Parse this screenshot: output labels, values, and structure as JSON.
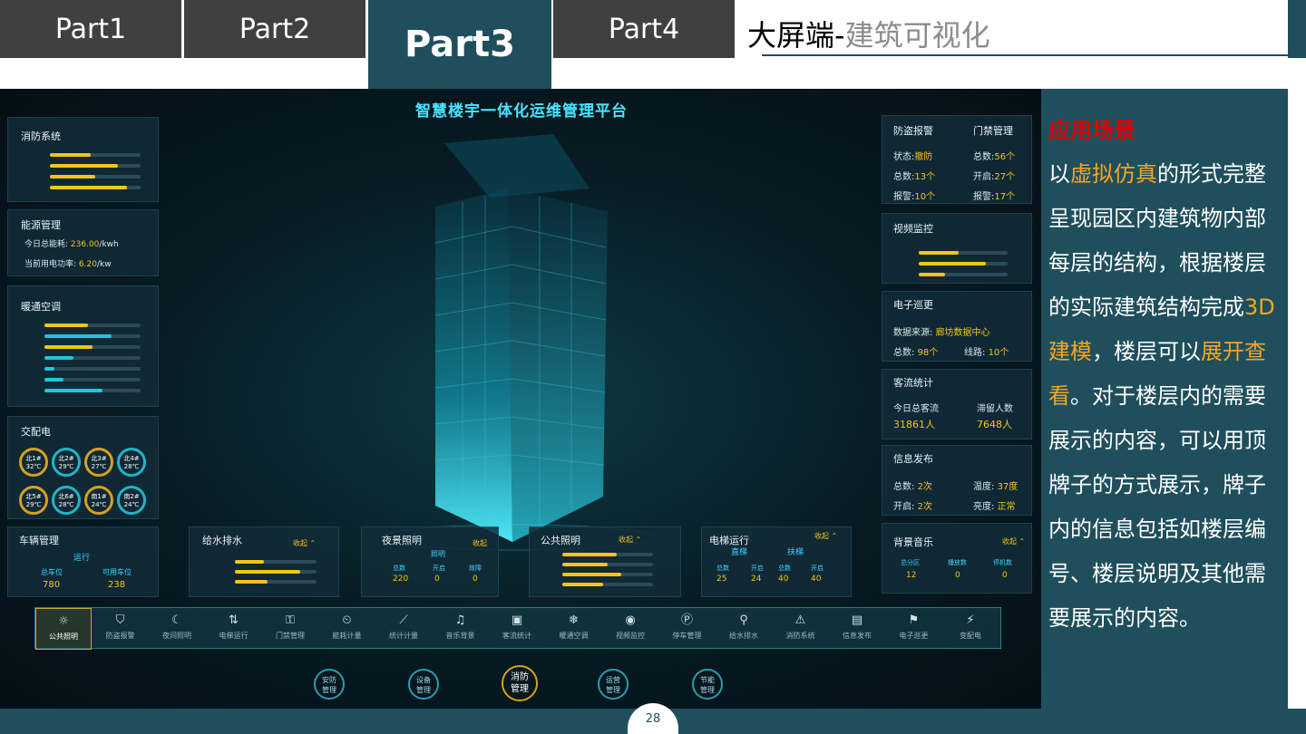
{
  "tabs": [
    {
      "label": "Part1"
    },
    {
      "label": "Part2"
    },
    {
      "label": "Part3"
    },
    {
      "label": "Part4"
    }
  ],
  "header": {
    "title_main": "大屏端-",
    "title_sub": "建筑可视化"
  },
  "platform": {
    "title": "智慧楼宇一体化运维管理平台"
  },
  "left": {
    "fire": {
      "title": "消防系统"
    },
    "energy": {
      "title": "能源管理",
      "today_label": "今日总能耗:",
      "today_value": "236.00",
      "today_unit": "/kwh",
      "power_label": "当前用电功率:",
      "power_value": "6.20",
      "power_unit": "/kw"
    },
    "hvac": {
      "title": "暖通空调"
    },
    "substation": {
      "title": "交配电",
      "rings": [
        "北1#\n32℃",
        "北2#\n29℃",
        "北3#\n27℃",
        "北4#\n28℃",
        "北5#\n29℃",
        "北6#\n28℃",
        "南1#\n24℃",
        "南2#\n24℃"
      ]
    },
    "vehicle": {
      "title": "车辆管理",
      "status": "运行",
      "total_label": "总车位",
      "total_value": "780",
      "free_label": "可用车位",
      "free_value": "238"
    }
  },
  "bottom_panels": {
    "water": {
      "title": "给水排水",
      "collapse": "收起 ⌃"
    },
    "night": {
      "title": "夜景照明",
      "collapse": "收起",
      "sub": "照明",
      "c1": "总数",
      "c2": "开启",
      "c3": "故障",
      "v1": "220",
      "v2": "0",
      "v3": "0"
    },
    "public": {
      "title": "公共照明",
      "collapse": "收起 ⌃"
    },
    "elevator": {
      "title": "电梯运行",
      "collapse": "收起 ⌃",
      "a": "直梯",
      "b": "扶梯",
      "c1": "总数",
      "c2": "开启",
      "c3": "总数",
      "c4": "开启",
      "v1": "25",
      "v2": "24",
      "v3": "40",
      "v4": "40"
    }
  },
  "right": {
    "security": {
      "title1": "防盗报警",
      "title2": "门禁管理",
      "status_label": "状态:",
      "status_value": "撤防",
      "total_label": "总数:",
      "total_value": "13个",
      "alarm_label": "报警:",
      "alarm_value": "10个",
      "d_total_label": "总数:",
      "d_total_value": "56个",
      "d_open_label": "开启:",
      "d_open_value": "27个",
      "d_alarm_label": "报警:",
      "d_alarm_value": "17个"
    },
    "video": {
      "title": "视频监控"
    },
    "patrol": {
      "title": "电子巡更",
      "src_label": "数据来源:",
      "src_value": "廊坊数据中心",
      "total_label": "总数:",
      "total_value": "98个",
      "line_label": "线路:",
      "line_value": "10个"
    },
    "flow": {
      "title": "客流统计",
      "today_label": "今日总客流",
      "today_value": "31861人",
      "stay_label": "滞留人数",
      "stay_value": "7648人"
    },
    "info": {
      "title": "信息发布",
      "total_label": "总数:",
      "total_value": "2次",
      "temp_label": "温度:",
      "temp_value": "37度",
      "open_label": "开启:",
      "open_value": "2次",
      "bright_label": "亮度:",
      "bright_value": "正常"
    },
    "music": {
      "title": "背景音乐",
      "collapse": "收起 ⌃",
      "c1": "总分区",
      "c2": "播放数",
      "c3": "停机数",
      "v1": "12",
      "v2": "0",
      "v3": "0"
    }
  },
  "dock": [
    {
      "label": "公共照明",
      "icon": "☼"
    },
    {
      "label": "防盗报警",
      "icon": "⛉"
    },
    {
      "label": "夜间照明",
      "icon": "☾"
    },
    {
      "label": "电梯运行",
      "icon": "⇅"
    },
    {
      "label": "门禁管理",
      "icon": "⚿"
    },
    {
      "label": "能耗计量",
      "icon": "⏲"
    },
    {
      "label": "统计计量",
      "icon": "⟋"
    },
    {
      "label": "音乐背景",
      "icon": "♫"
    },
    {
      "label": "客流统计",
      "icon": "▣"
    },
    {
      "label": "暖通空调",
      "icon": "❄"
    },
    {
      "label": "视频监控",
      "icon": "◉"
    },
    {
      "label": "停车管理",
      "icon": "Ⓟ"
    },
    {
      "label": "给水排水",
      "icon": "⚲"
    },
    {
      "label": "消防系统",
      "icon": "⚠"
    },
    {
      "label": "信息发布",
      "icon": "▤"
    },
    {
      "label": "电子巡更",
      "icon": "⚑"
    },
    {
      "label": "变配电",
      "icon": "⚡"
    }
  ],
  "modes": [
    {
      "label": "安防\n管理"
    },
    {
      "label": "设备\n管理"
    },
    {
      "label": "消防\n管理"
    },
    {
      "label": "运营\n管理"
    },
    {
      "label": "节能\n管理"
    }
  ],
  "sidebar": {
    "heading": "应用场景",
    "p1": "以",
    "h1": "虚拟仿真",
    "p2": "的形式完整呈现园区内建筑物内部每层的结构，根据楼层的实际建筑结构完成",
    "h2": "3D建模",
    "p3": "，楼层可以",
    "h3": "展开查看",
    "p4": "。对于楼层内的需要展示的内容，可以用顶牌子的方式展示，牌子内的信息包括如楼层编号、楼层说明及其他需要展示的内容。"
  },
  "page": {
    "number": "28"
  }
}
